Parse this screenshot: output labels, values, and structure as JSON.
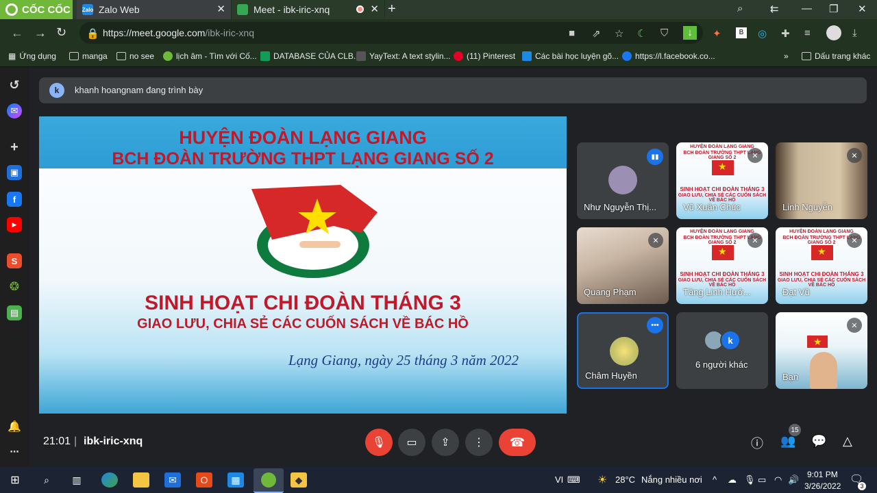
{
  "browser": {
    "brand": "CỐC CỐC",
    "tabs": [
      {
        "title": "Zalo Web",
        "favicon": "Zalo"
      },
      {
        "title": "Meet - ibk-iric-xnq"
      }
    ],
    "url_host": "https://meet.google.com",
    "url_path": "/ibk-iric-xnq",
    "bookmarks": [
      "Ứng dụng",
      "manga",
      "no see",
      "lịch âm - Tìm với Cố...",
      "DATABASE CỦA CLB...",
      "YayText: A text stylin...",
      "(11) Pinterest",
      "Các bài học luyện gõ...",
      "https://l.facebook.co..."
    ],
    "bookmarks_more": "»",
    "bookmarks_other": "Dấu trang khác"
  },
  "meet": {
    "presenter_initial": "k",
    "presenting_text": "khanh hoangnam đang trình bày",
    "slide": {
      "line1": "HUYỆN ĐOÀN LẠNG GIANG",
      "line2": "BCH ĐOÀN TRƯỜNG THPT LẠNG GIANG SỐ 2",
      "main": "SINH HOẠT CHI ĐOÀN THÁNG 3",
      "sub": "GIAO LƯU, CHIA SẺ CÁC CUỐN SÁCH VỀ BÁC HỒ",
      "date": "Lạng Giang, ngày 25 tháng 3 năm 2022"
    },
    "mini_slide": {
      "t1": "HUYỆN ĐOÀN LẠNG GIANG",
      "t2": "BCH ĐOÀN TRƯỜNG THPT LẠNG GIANG SỐ 2",
      "t3": "SINH HOẠT CHI ĐOÀN THÁNG 3",
      "t4": "GIAO LƯU, CHIA SẺ CÁC CUỐN SÁCH VỀ BÁC HỒ"
    },
    "participants": [
      {
        "name": "Như Nguyễn Thị..."
      },
      {
        "name": "Vũ Xuân Chúc"
      },
      {
        "name": "Linh Nguyễn"
      },
      {
        "name": "Quang Phạm"
      },
      {
        "name": "Tăng Linh Hưở..."
      },
      {
        "name": "Đạt Vũ"
      },
      {
        "name": "Châm Huyền"
      },
      {
        "name": "6 người khác",
        "avatar_initial": "k"
      },
      {
        "name": "Bạn"
      }
    ],
    "clock": "21:01",
    "divider": "|",
    "meeting_code": "ibk-iric-xnq",
    "people_count": "15"
  },
  "taskbar": {
    "lang": "VI",
    "weather_temp": "28°C",
    "weather_text": "Nắng nhiều nơi",
    "time": "9:01 PM",
    "date": "3/26/2022",
    "notif_count": "3"
  },
  "icons": {
    "back": "←",
    "forward": "→",
    "reload": "↻",
    "close": "✕",
    "plus": "+",
    "mic_off": "🎙",
    "camera": "▭",
    "present": "⇪",
    "more": "⋮",
    "hangup": "☎",
    "info": "ⓘ",
    "people": "👥",
    "chat": "💬",
    "activities": "△"
  }
}
